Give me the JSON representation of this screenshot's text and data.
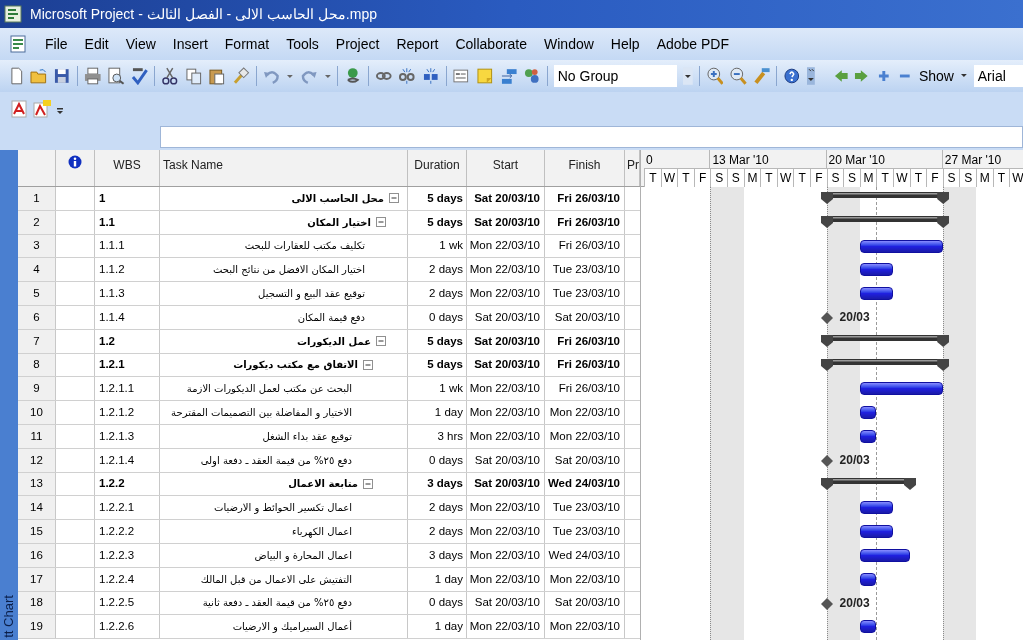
{
  "window": {
    "title": "Microsoft Project - محل الحاسب الالى - الفصل الثالث.mpp"
  },
  "menu": [
    {
      "label": "File"
    },
    {
      "label": "Edit"
    },
    {
      "label": "View"
    },
    {
      "label": "Insert"
    },
    {
      "label": "Format"
    },
    {
      "label": "Tools"
    },
    {
      "label": "Project"
    },
    {
      "label": "Report"
    },
    {
      "label": "Collaborate"
    },
    {
      "label": "Window"
    },
    {
      "label": "Help"
    },
    {
      "label": "Adobe PDF"
    }
  ],
  "toolbar": {
    "group_value": "No Group",
    "show_label": "Show",
    "font_value": "Arial"
  },
  "side_tab": {
    "label": "tt Chart"
  },
  "table": {
    "columns": [
      "WBS",
      "Task Name",
      "Duration",
      "Start",
      "Finish",
      "Pr"
    ],
    "tasks": [
      {
        "id": "1",
        "wbs": "1",
        "name": "محل الحاسب الالى",
        "duration": "5 days",
        "start": "Sat 20/03/10",
        "finish": "Fri 26/03/10",
        "kind": "summary",
        "expanded": true,
        "children": [
          {
            "id": "2",
            "wbs": "1.1",
            "name": "اختيار المكان",
            "duration": "5 days",
            "start": "Sat 20/03/10",
            "finish": "Fri 26/03/10",
            "kind": "summary",
            "expanded": true,
            "children": [
              {
                "id": "3",
                "wbs": "1.1.1",
                "name": "تكليف مكتب للعقارات للبحث",
                "duration": "1 wk",
                "start": "Mon 22/03/10",
                "finish": "Fri 26/03/10",
                "kind": "task"
              },
              {
                "id": "4",
                "wbs": "1.1.2",
                "name": "اختيار المكان الافضل من نتائج البحث",
                "duration": "2 days",
                "start": "Mon 22/03/10",
                "finish": "Tue 23/03/10",
                "kind": "task"
              },
              {
                "id": "5",
                "wbs": "1.1.3",
                "name": "توقيع عقد البيع و التسجيل",
                "duration": "2 days",
                "start": "Mon 22/03/10",
                "finish": "Tue 23/03/10",
                "kind": "task"
              },
              {
                "id": "6",
                "wbs": "1.1.4",
                "name": "دفع قيمة المكان",
                "duration": "0 days",
                "start": "Sat 20/03/10",
                "finish": "Sat 20/03/10",
                "kind": "milestone",
                "bar_label": "20/03"
              }
            ]
          },
          {
            "id": "7",
            "wbs": "1.2",
            "name": "عمل الديكورات",
            "duration": "5 days",
            "start": "Sat 20/03/10",
            "finish": "Fri 26/03/10",
            "kind": "summary",
            "expanded": true,
            "children": [
              {
                "id": "8",
                "wbs": "1.2.1",
                "name": "الاتفاق مع مكتب ديكورات",
                "duration": "5 days",
                "start": "Sat 20/03/10",
                "finish": "Fri 26/03/10",
                "kind": "summary",
                "expanded": true,
                "children": [
                  {
                    "id": "9",
                    "wbs": "1.2.1.1",
                    "name": "البحث عن مكتب لعمل الديكورات الازمة",
                    "duration": "1 wk",
                    "start": "Mon 22/03/10",
                    "finish": "Fri 26/03/10",
                    "kind": "task"
                  },
                  {
                    "id": "10",
                    "wbs": "1.2.1.2",
                    "name": "الاختيار و المفاضلة بين التصميمات المقترحة",
                    "duration": "1 day",
                    "start": "Mon 22/03/10",
                    "finish": "Mon 22/03/10",
                    "kind": "task"
                  },
                  {
                    "id": "11",
                    "wbs": "1.2.1.3",
                    "name": "توقيع عقد بداء الشغل",
                    "duration": "3 hrs",
                    "start": "Mon 22/03/10",
                    "finish": "Mon 22/03/10",
                    "kind": "task"
                  },
                  {
                    "id": "12",
                    "wbs": "1.2.1.4",
                    "name": "دفع ٢٥% من قيمة العقد ـ دفعة اولى",
                    "duration": "0 days",
                    "start": "Sat 20/03/10",
                    "finish": "Sat 20/03/10",
                    "kind": "milestone",
                    "bar_label": "20/03"
                  }
                ]
              },
              {
                "id": "13",
                "wbs": "1.2.2",
                "name": "متابعة الاعمال",
                "duration": "3 days",
                "start": "Sat 20/03/10",
                "finish": "Wed 24/03/10",
                "kind": "summary",
                "expanded": true,
                "children": [
                  {
                    "id": "14",
                    "wbs": "1.2.2.1",
                    "name": "اعمال تكسير الحوائط و الارضيات",
                    "duration": "2 days",
                    "start": "Mon 22/03/10",
                    "finish": "Tue 23/03/10",
                    "kind": "task"
                  },
                  {
                    "id": "15",
                    "wbs": "1.2.2.2",
                    "name": "اعمال الكهرباء",
                    "duration": "2 days",
                    "start": "Mon 22/03/10",
                    "finish": "Tue 23/03/10",
                    "kind": "task"
                  },
                  {
                    "id": "16",
                    "wbs": "1.2.2.3",
                    "name": "اعمال المحارة و البياض",
                    "duration": "3 days",
                    "start": "Mon 22/03/10",
                    "finish": "Wed 24/03/10",
                    "kind": "task"
                  },
                  {
                    "id": "17",
                    "wbs": "1.2.2.4",
                    "name": "التفتيش على الاعمال من قبل المالك",
                    "duration": "1 day",
                    "start": "Mon 22/03/10",
                    "finish": "Mon 22/03/10",
                    "kind": "task"
                  },
                  {
                    "id": "18",
                    "wbs": "1.2.2.5",
                    "name": "دفع ٢٥% من قيمة العقد ـ دفعة ثانية",
                    "duration": "0 days",
                    "start": "Sat 20/03/10",
                    "finish": "Sat 20/03/10",
                    "kind": "milestone",
                    "bar_label": "20/03"
                  },
                  {
                    "id": "19",
                    "wbs": "1.2.2.6",
                    "name": "أعمال السيراميك و الارضيات",
                    "duration": "1 day",
                    "start": "Mon 22/03/10",
                    "finish": "Mon 22/03/10",
                    "kind": "task"
                  }
                ]
              }
            ]
          }
        ]
      }
    ]
  },
  "timescale": {
    "weeks": [
      "0",
      "13 Mar '10",
      "20 Mar '10",
      "27 Mar '10"
    ],
    "days": [
      {
        "label": "T",
        "nonworking": false
      },
      {
        "label": "W",
        "nonworking": false
      },
      {
        "label": "T",
        "nonworking": false
      },
      {
        "label": "F",
        "nonworking": false
      },
      {
        "label": "S",
        "nonworking": true
      },
      {
        "label": "S",
        "nonworking": true
      },
      {
        "label": "M",
        "nonworking": false
      },
      {
        "label": "T",
        "nonworking": false
      },
      {
        "label": "W",
        "nonworking": false
      },
      {
        "label": "T",
        "nonworking": false
      },
      {
        "label": "F",
        "nonworking": false
      },
      {
        "label": "S",
        "nonworking": true
      },
      {
        "label": "S",
        "nonworking": true
      },
      {
        "label": "M",
        "nonworking": false
      },
      {
        "label": "T",
        "nonworking": false,
        "today": true
      },
      {
        "label": "W",
        "nonworking": false
      },
      {
        "label": "T",
        "nonworking": false
      },
      {
        "label": "F",
        "nonworking": false
      },
      {
        "label": "S",
        "nonworking": true
      },
      {
        "label": "S",
        "nonworking": true
      },
      {
        "label": "M",
        "nonworking": false
      },
      {
        "label": "T",
        "nonworking": false
      },
      {
        "label": "W",
        "nonworking": false
      }
    ]
  }
}
